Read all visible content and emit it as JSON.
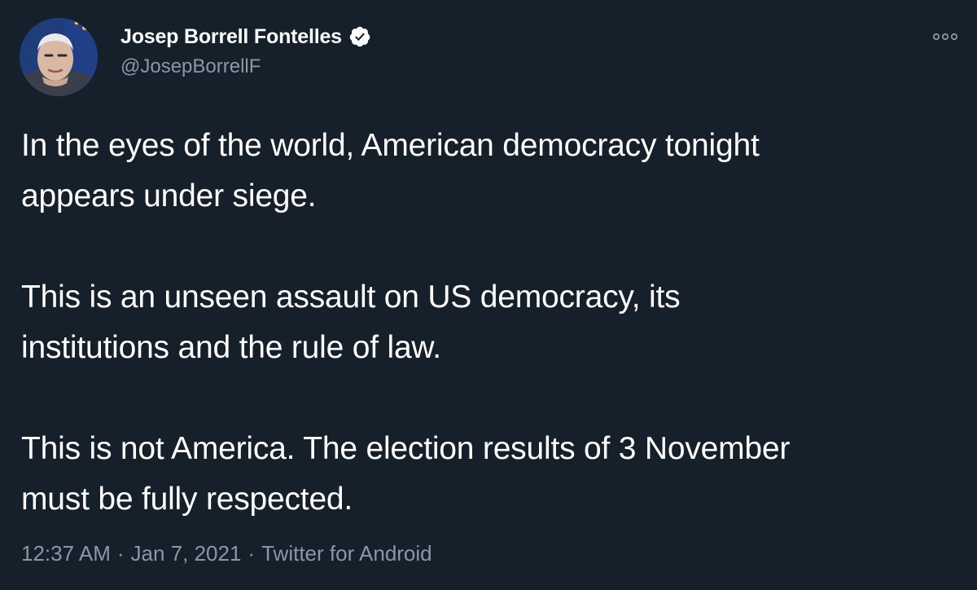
{
  "author": {
    "display_name": "Josep Borrell Fontelles",
    "handle": "@JosepBorrellF",
    "verified": true,
    "avatar_icon": "profile-photo"
  },
  "tweet": {
    "paragraphs": [
      "In the eyes of the world, American democracy tonight\nappears under siege.",
      "This is an unseen assault on US democracy, its\ninstitutions and the rule of law.",
      "This is not America. The election results of 3 November\nmust be fully respected."
    ]
  },
  "meta": {
    "time": "12:37 AM",
    "separator": "·",
    "date": "Jan 7, 2021",
    "source": "Twitter for Android"
  },
  "icons": {
    "more": "more-dots-icon",
    "verified": "verified-badge-icon"
  },
  "colors": {
    "background": "#15202b",
    "text_primary": "#ffffff",
    "text_secondary": "#8899a6",
    "verified_badge": "#ffffff"
  }
}
